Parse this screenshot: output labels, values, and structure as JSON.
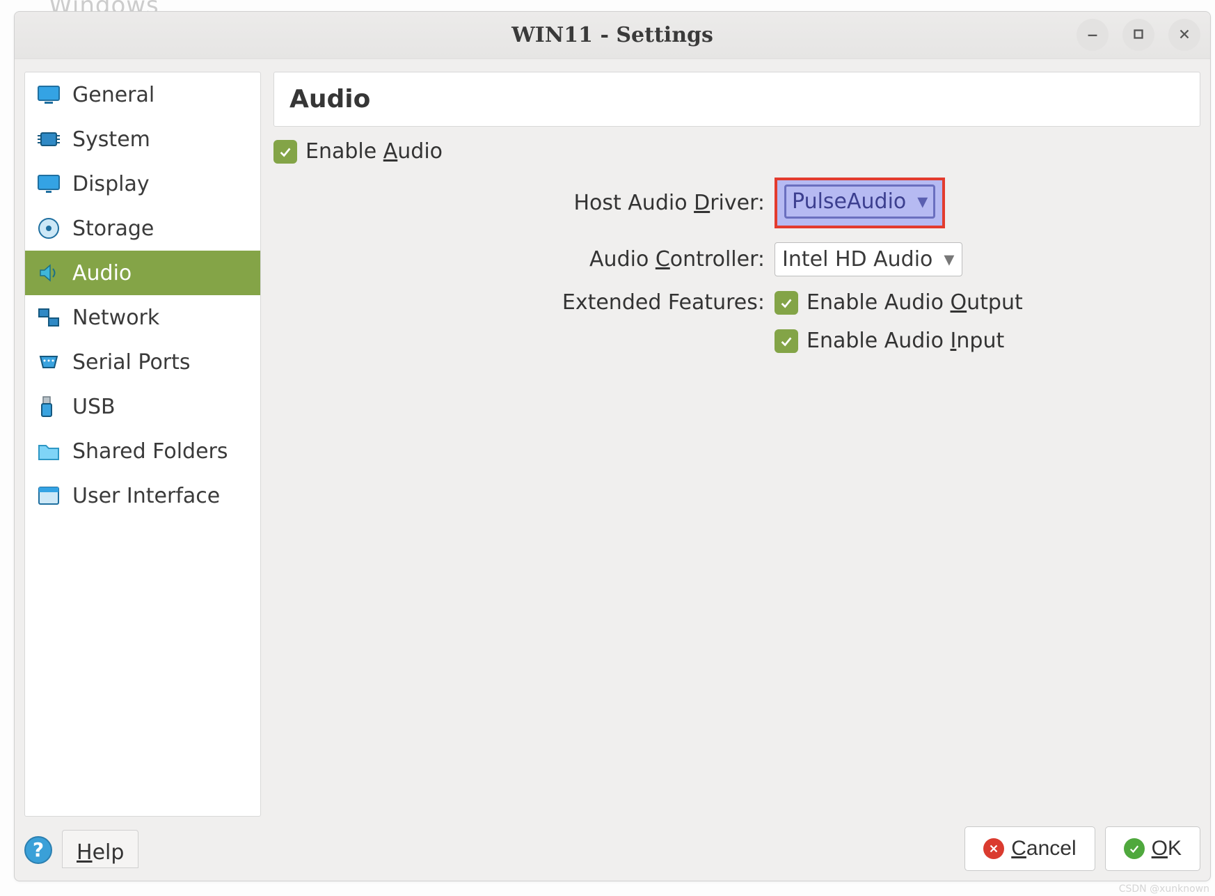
{
  "behind_window_text": "Windows",
  "titlebar": {
    "title": "WIN11 - Settings"
  },
  "sidebar": {
    "items": [
      {
        "id": "general",
        "label": "General"
      },
      {
        "id": "system",
        "label": "System"
      },
      {
        "id": "display",
        "label": "Display"
      },
      {
        "id": "storage",
        "label": "Storage"
      },
      {
        "id": "audio",
        "label": "Audio",
        "selected": true
      },
      {
        "id": "network",
        "label": "Network"
      },
      {
        "id": "serial-ports",
        "label": "Serial Ports"
      },
      {
        "id": "usb",
        "label": "USB"
      },
      {
        "id": "shared-folders",
        "label": "Shared Folders"
      },
      {
        "id": "user-interface",
        "label": "User Interface"
      }
    ]
  },
  "content": {
    "heading": "Audio",
    "enable_audio": {
      "checked": true,
      "pre": "Enable ",
      "u": "A",
      "post": "udio"
    },
    "host_driver": {
      "pre": "Host Audio ",
      "u": "D",
      "post": "river:",
      "value": "PulseAudio"
    },
    "audio_controller": {
      "pre": "Audio ",
      "u": "C",
      "post": "ontroller:",
      "value": "Intel HD Audio"
    },
    "extended_features_label": "Extended Features:",
    "enable_output": {
      "checked": true,
      "pre": "Enable Audio ",
      "u": "O",
      "post": "utput"
    },
    "enable_input": {
      "checked": true,
      "pre": "Enable Audio ",
      "u": "I",
      "post": "nput"
    }
  },
  "footer": {
    "help": {
      "u": "H",
      "post": "elp"
    },
    "cancel": {
      "u": "C",
      "post": "ancel"
    },
    "ok": {
      "u": "O",
      "post": "K"
    }
  },
  "watermark": "CSDN @xunknown"
}
